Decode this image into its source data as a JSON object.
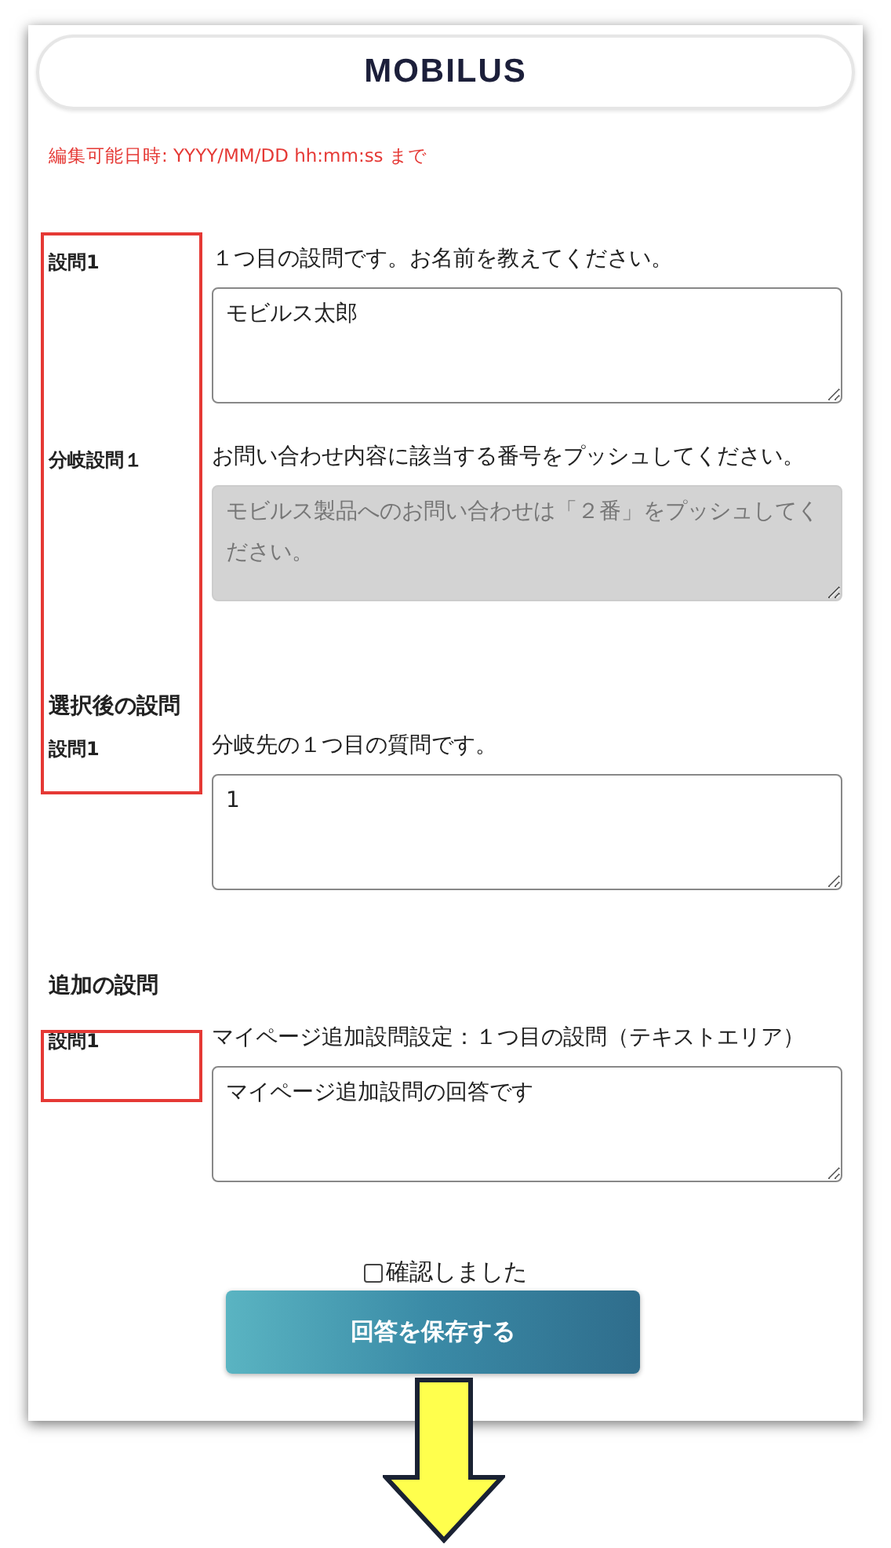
{
  "logo": "MOBILUS",
  "edit_deadline": "編集可能日時: YYYY/MM/DD hh:mm:ss まで",
  "sections": [
    {
      "questions": [
        {
          "label": "設問1",
          "text": "１つ目の設問です。お名前を教えてください。",
          "answer": "モビルス太郎",
          "disabled": false
        },
        {
          "label": "分岐設問１",
          "text": "お問い合わせ内容に該当する番号をプッシュしてください。",
          "answer": "モビルス製品へのお問い合わせは「２番」をプッシュしてください。",
          "disabled": true
        }
      ]
    },
    {
      "heading": "選択後の設問",
      "questions": [
        {
          "label": "設問1",
          "text": "分岐先の１つ目の質問です。",
          "answer": "1",
          "disabled": false
        }
      ]
    },
    {
      "heading": "追加の設問",
      "questions": [
        {
          "label": "設問1",
          "text": "マイページ追加設問設定：１つ目の設問（テキストエリア）",
          "answer": "マイページ追加設問の回答です",
          "disabled": false
        }
      ]
    }
  ],
  "confirm": {
    "label": "確認しました",
    "checked": false
  },
  "save_button": "回答を保存する"
}
